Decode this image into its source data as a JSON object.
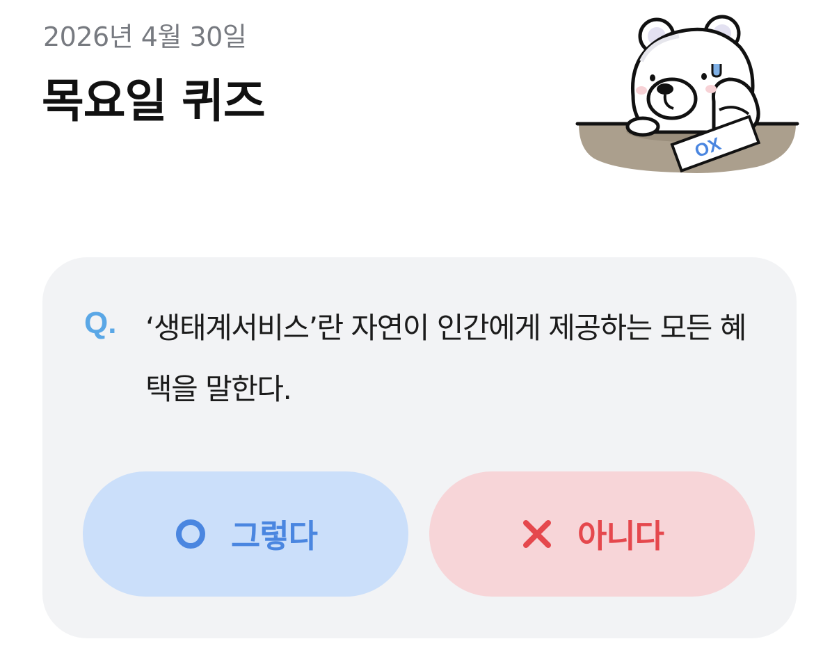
{
  "header": {
    "date": "2026년 4월 30일",
    "title": "목요일 퀴즈"
  },
  "mascot": {
    "icon": "polar-bear-ox-quiz-mascot",
    "sheet_marks": "OX"
  },
  "quiz": {
    "q_label": "Q.",
    "question": "‘생태계서비스’란 자연이 인간에게 제공하는 모든 혜택을 말한다.",
    "options": [
      {
        "icon": "circle-o-icon",
        "label": "그렇다",
        "color": "#4a86e0",
        "bg": "#cbdffa"
      },
      {
        "icon": "cross-x-icon",
        "label": "아니다",
        "color": "#e5484d",
        "bg": "#f7d5d8"
      }
    ]
  },
  "colors": {
    "q_accent": "#5aa7e6",
    "card_bg": "#f2f3f5",
    "desk": "#ab9f8d"
  }
}
